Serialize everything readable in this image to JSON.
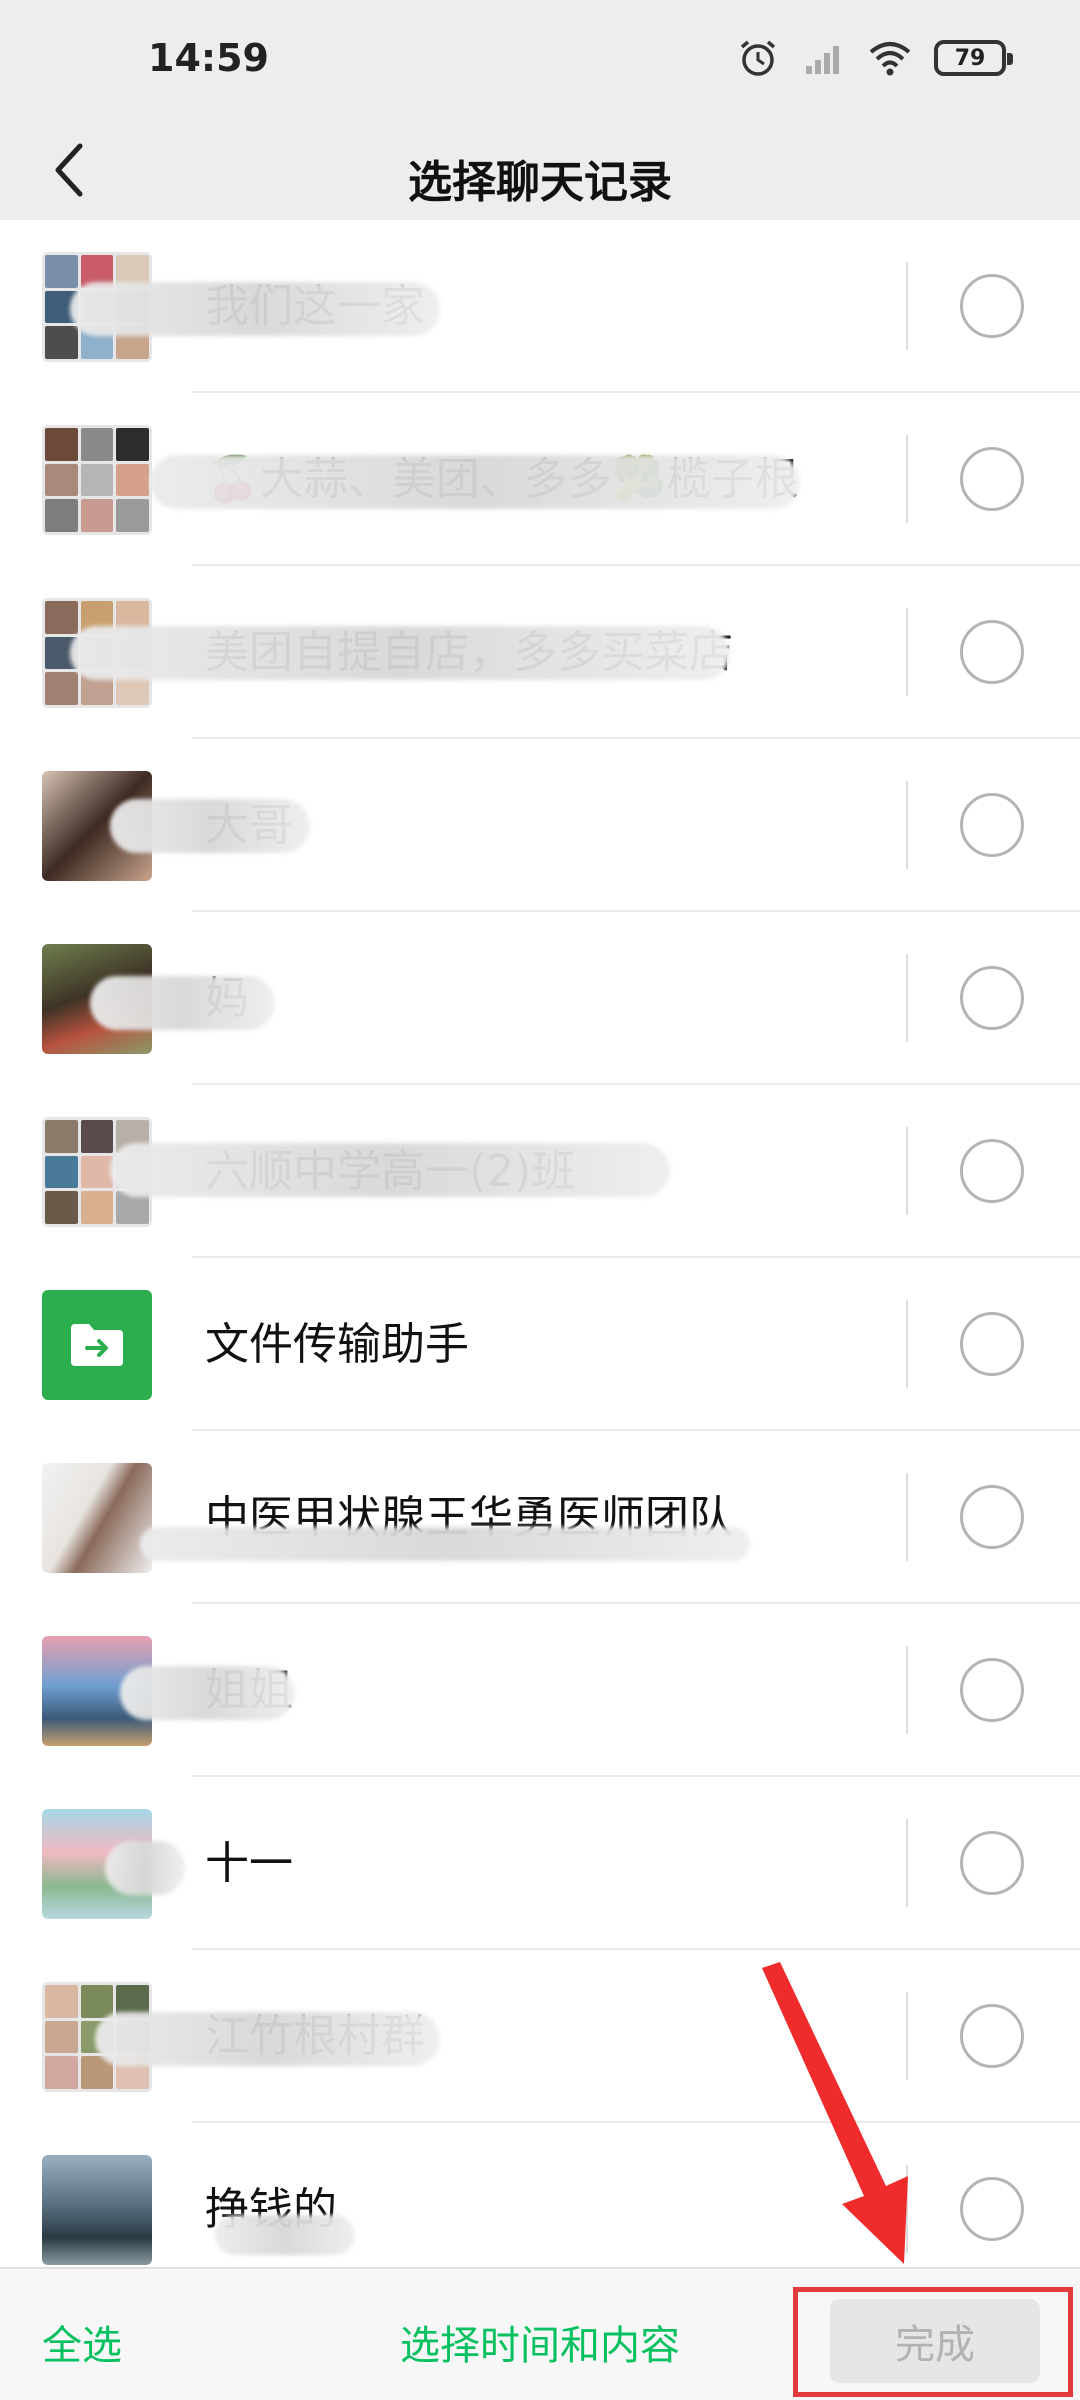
{
  "status_bar": {
    "time": "14:59",
    "battery": "79"
  },
  "nav": {
    "title": "选择聊天记录"
  },
  "chats": [
    {
      "name": "我们这一家"
    },
    {
      "name": "🍒大蒜、美团、多多🥦榄子根"
    },
    {
      "name": "美团自提自店，多多买菜店"
    },
    {
      "name": "大哥"
    },
    {
      "name": "妈"
    },
    {
      "name": "六顺中学高一(2)班"
    },
    {
      "name": "文件传输助手"
    },
    {
      "name": "中医甲状腺王华勇医师团队"
    },
    {
      "name": "姐姐"
    },
    {
      "name": "十一"
    },
    {
      "name": "江竹根村群"
    },
    {
      "name": "挣钱的"
    }
  ],
  "bottom": {
    "select_all": "全选",
    "select_time": "选择时间和内容",
    "complete": "完成"
  },
  "colors": {
    "accent": "#07c160",
    "highlight": "#e23b3b"
  }
}
